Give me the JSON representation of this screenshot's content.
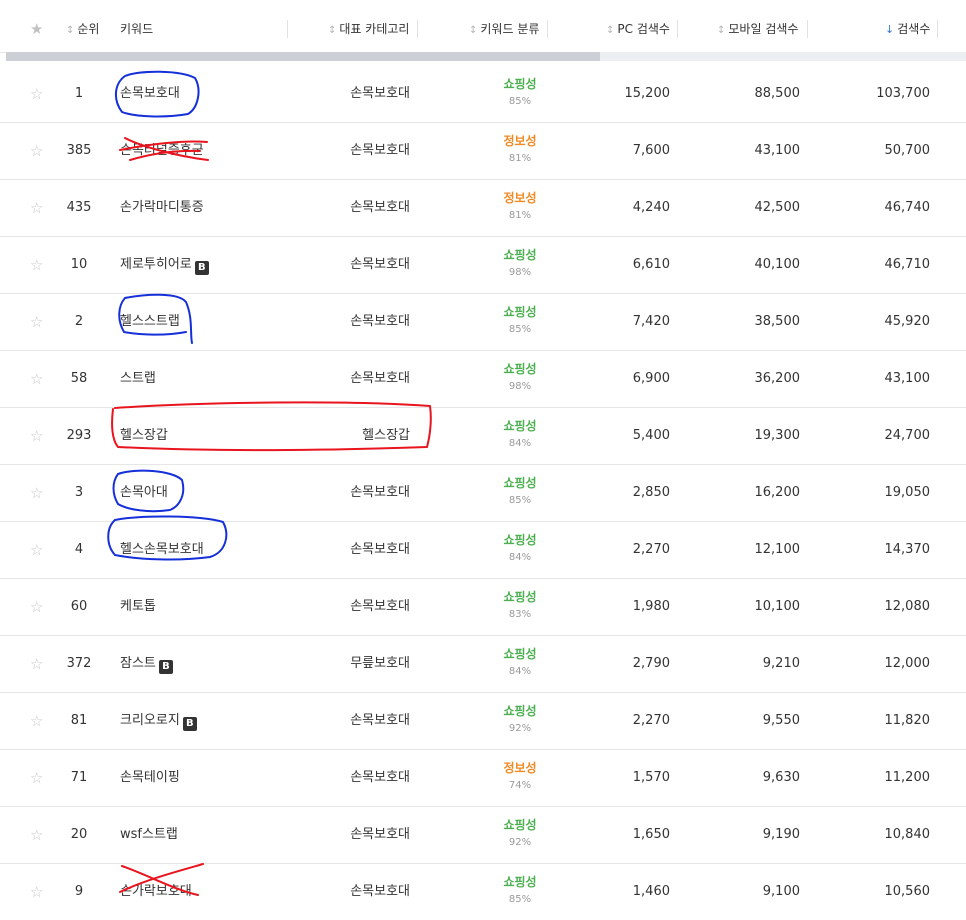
{
  "header": {
    "star_icon": "star-icon",
    "rank": "순위",
    "keyword": "키워드",
    "category": "대표 카테고리",
    "classification": "키워드 분류",
    "pc": "PC 검색수",
    "mobile": "모바일 검색수",
    "total": "검색수",
    "sort_arrow": "↕",
    "active_sort_arrow": "↓"
  },
  "colors": {
    "shopping": "#4caf50",
    "info": "#f08a24",
    "accent": "#3a78d6",
    "blue_mark": "#1530d8",
    "red_mark": "#e8141e"
  },
  "rows": [
    {
      "rank": "1",
      "keyword": "손목보호대",
      "badge": "",
      "category": "손목보호대",
      "cls": "쇼핑성",
      "pct": "85%",
      "type": "shopping",
      "pc": "15,200",
      "mobile": "88,500",
      "total": "103,700"
    },
    {
      "rank": "385",
      "keyword": "손목터널증후군",
      "badge": "",
      "category": "손목보호대",
      "cls": "정보성",
      "pct": "81%",
      "type": "info",
      "pc": "7,600",
      "mobile": "43,100",
      "total": "50,700"
    },
    {
      "rank": "435",
      "keyword": "손가락마디통증",
      "badge": "",
      "category": "손목보호대",
      "cls": "정보성",
      "pct": "81%",
      "type": "info",
      "pc": "4,240",
      "mobile": "42,500",
      "total": "46,740"
    },
    {
      "rank": "10",
      "keyword": "제로투히어로",
      "badge": "B",
      "category": "손목보호대",
      "cls": "쇼핑성",
      "pct": "98%",
      "type": "shopping",
      "pc": "6,610",
      "mobile": "40,100",
      "total": "46,710"
    },
    {
      "rank": "2",
      "keyword": "헬스스트랩",
      "badge": "",
      "category": "손목보호대",
      "cls": "쇼핑성",
      "pct": "85%",
      "type": "shopping",
      "pc": "7,420",
      "mobile": "38,500",
      "total": "45,920"
    },
    {
      "rank": "58",
      "keyword": "스트랩",
      "badge": "",
      "category": "손목보호대",
      "cls": "쇼핑성",
      "pct": "98%",
      "type": "shopping",
      "pc": "6,900",
      "mobile": "36,200",
      "total": "43,100"
    },
    {
      "rank": "293",
      "keyword": "헬스장갑",
      "badge": "",
      "category": "헬스장갑",
      "cls": "쇼핑성",
      "pct": "84%",
      "type": "shopping",
      "pc": "5,400",
      "mobile": "19,300",
      "total": "24,700"
    },
    {
      "rank": "3",
      "keyword": "손목아대",
      "badge": "",
      "category": "손목보호대",
      "cls": "쇼핑성",
      "pct": "85%",
      "type": "shopping",
      "pc": "2,850",
      "mobile": "16,200",
      "total": "19,050"
    },
    {
      "rank": "4",
      "keyword": "헬스손목보호대",
      "badge": "",
      "category": "손목보호대",
      "cls": "쇼핑성",
      "pct": "84%",
      "type": "shopping",
      "pc": "2,270",
      "mobile": "12,100",
      "total": "14,370"
    },
    {
      "rank": "60",
      "keyword": "케토톱",
      "badge": "",
      "category": "손목보호대",
      "cls": "쇼핑성",
      "pct": "83%",
      "type": "shopping",
      "pc": "1,980",
      "mobile": "10,100",
      "total": "12,080"
    },
    {
      "rank": "372",
      "keyword": "잠스트",
      "badge": "B",
      "category": "무릎보호대",
      "cls": "쇼핑성",
      "pct": "84%",
      "type": "shopping",
      "pc": "2,790",
      "mobile": "9,210",
      "total": "12,000"
    },
    {
      "rank": "81",
      "keyword": "크리오로지",
      "badge": "B",
      "category": "손목보호대",
      "cls": "쇼핑성",
      "pct": "92%",
      "type": "shopping",
      "pc": "2,270",
      "mobile": "9,550",
      "total": "11,820"
    },
    {
      "rank": "71",
      "keyword": "손목테이핑",
      "badge": "",
      "category": "손목보호대",
      "cls": "정보성",
      "pct": "74%",
      "type": "info",
      "pc": "1,570",
      "mobile": "9,630",
      "total": "11,200"
    },
    {
      "rank": "20",
      "keyword": "wsf스트랩",
      "badge": "",
      "category": "손목보호대",
      "cls": "쇼핑성",
      "pct": "92%",
      "type": "shopping",
      "pc": "1,650",
      "mobile": "9,190",
      "total": "10,840"
    },
    {
      "rank": "9",
      "keyword": "손가락보호대",
      "badge": "",
      "category": "손목보호대",
      "cls": "쇼핑성",
      "pct": "85%",
      "type": "shopping",
      "pc": "1,460",
      "mobile": "9,100",
      "total": "10,560"
    }
  ]
}
